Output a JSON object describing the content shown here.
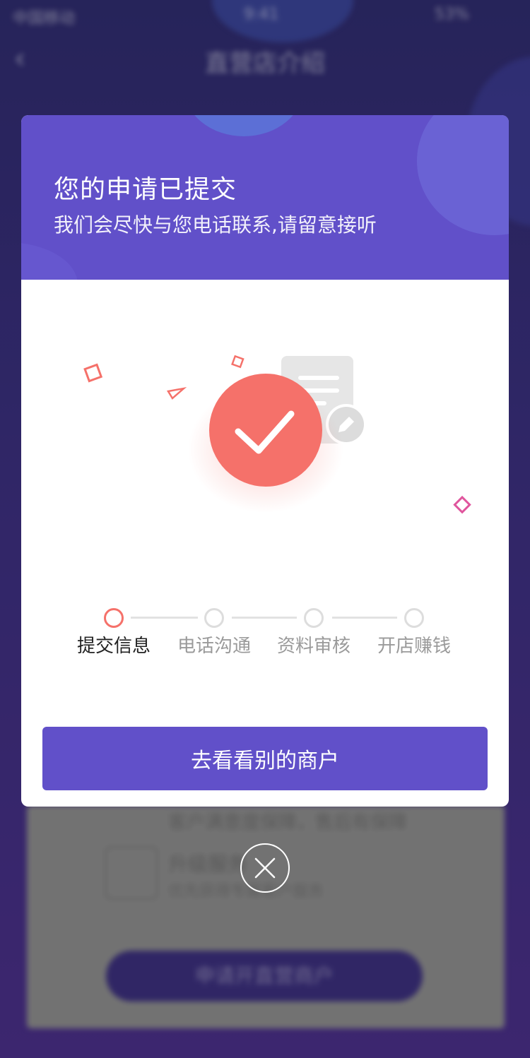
{
  "background": {
    "status_bar": {
      "carrier": "中国移动",
      "time": "9:41",
      "battery": "53%"
    },
    "nav": {
      "back_icon": "chevron-left-icon",
      "title": "直营店介绍"
    },
    "card": {
      "line1": "客户满意度保障，售后有保障",
      "feature_title": "升级服务",
      "feature_desc": "优先获得专属客户服务",
      "apply_button": "申请开直营商户"
    }
  },
  "modal": {
    "title": "您的申请已提交",
    "subtitle": "我们会尽快与您电话联系,请留意接听",
    "illustration": {
      "icon": "success-check-icon",
      "accent_color": "#F5716A"
    },
    "steps": [
      {
        "label": "提交信息",
        "active": true
      },
      {
        "label": "电话沟通",
        "active": false
      },
      {
        "label": "资料审核",
        "active": false
      },
      {
        "label": "开店赚钱",
        "active": false
      }
    ],
    "primary_button": "去看看别的商户",
    "close_icon": "close-icon"
  },
  "colors": {
    "brand": "#6150C9",
    "success": "#F5716A",
    "inactive": "#DDDDDD"
  }
}
